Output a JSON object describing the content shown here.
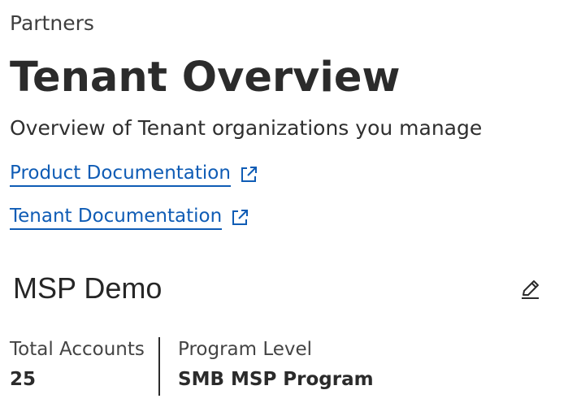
{
  "header": {
    "breadcrumb": "Partners",
    "title": "Tenant Overview",
    "subtitle": "Overview of Tenant organizations you manage"
  },
  "links": [
    {
      "label": "Product Documentation",
      "icon": "external-link-icon"
    },
    {
      "label": "Tenant Documentation",
      "icon": "external-link-icon"
    }
  ],
  "tenant": {
    "name": "MSP Demo",
    "edit_icon": "pencil-icon",
    "stats": {
      "total_accounts_label": "Total Accounts",
      "total_accounts_value": "25",
      "program_level_label": "Program Level",
      "program_level_value": "SMB MSP Program"
    }
  },
  "colors": {
    "link": "#0f5cb5",
    "text": "#2b2b2b"
  }
}
